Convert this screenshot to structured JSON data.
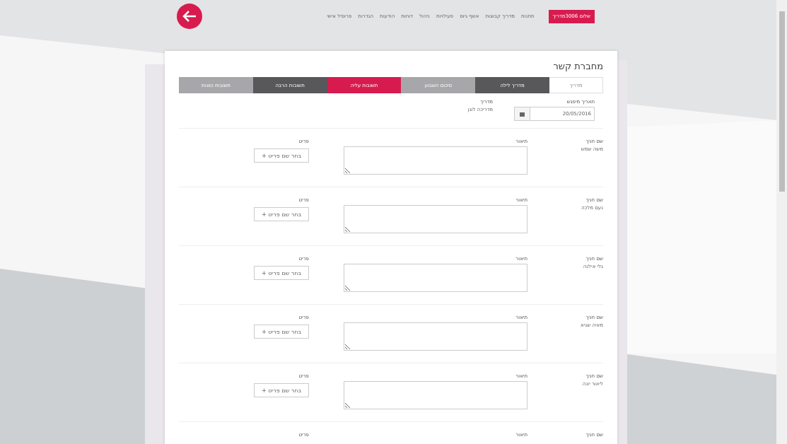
{
  "header": {
    "nav": [
      "תחנות",
      "מדריך קבוצות",
      "אשף גיוס",
      "פעילויות",
      "ניהול",
      "דוחות",
      "הודעות",
      "הגדרות",
      "פרופיל אישי"
    ],
    "user_button": "שלום 3006מדריך"
  },
  "page": {
    "title": "מחברת קשר",
    "tabs": [
      {
        "label": "מדריך",
        "kind": "plain",
        "selected": false
      },
      {
        "label": "מדריך לילה",
        "kind": "dark",
        "selected": false
      },
      {
        "label": "סיכום השבוע",
        "kind": "light",
        "selected": false
      },
      {
        "label": "תשובות עליה",
        "kind": "accent",
        "selected": true
      },
      {
        "label": "תשובות הרבה",
        "kind": "dark",
        "selected": false
      },
      {
        "label": "תשובות כוונות",
        "kind": "light",
        "selected": false
      }
    ],
    "meeting_date": {
      "label": "תאריך מיפגש",
      "value": "20/05/2016"
    },
    "guide": {
      "label": "מדריך",
      "value": "מדריכה לוגן"
    },
    "rows": [
      {
        "name_label": "שם חניך",
        "name": "משה שמש",
        "note_label": "תיאור",
        "item_label": "פריט",
        "item_button": "בחר שם פריט +"
      },
      {
        "name_label": "שם חניך",
        "name": "נעם מלכה",
        "note_label": "תיאור",
        "item_label": "פריט",
        "item_button": "בחר שם פריט +"
      },
      {
        "name_label": "שם חניך",
        "name": "גלי אילנה",
        "note_label": "תיאור",
        "item_label": "פריט",
        "item_button": "בחר שם פריט +"
      },
      {
        "name_label": "שם חניך",
        "name": "מאיה שגיא",
        "note_label": "תיאור",
        "item_label": "פריט",
        "item_button": "בחר שם פריט +"
      },
      {
        "name_label": "שם חניך",
        "name": "ליאור יונה",
        "note_label": "תיאור",
        "item_label": "פריט",
        "item_button": "בחר שם פריט +"
      },
      {
        "name_label": "שם חניך",
        "note_label": "תיאור",
        "item_label": "פריט"
      }
    ]
  }
}
